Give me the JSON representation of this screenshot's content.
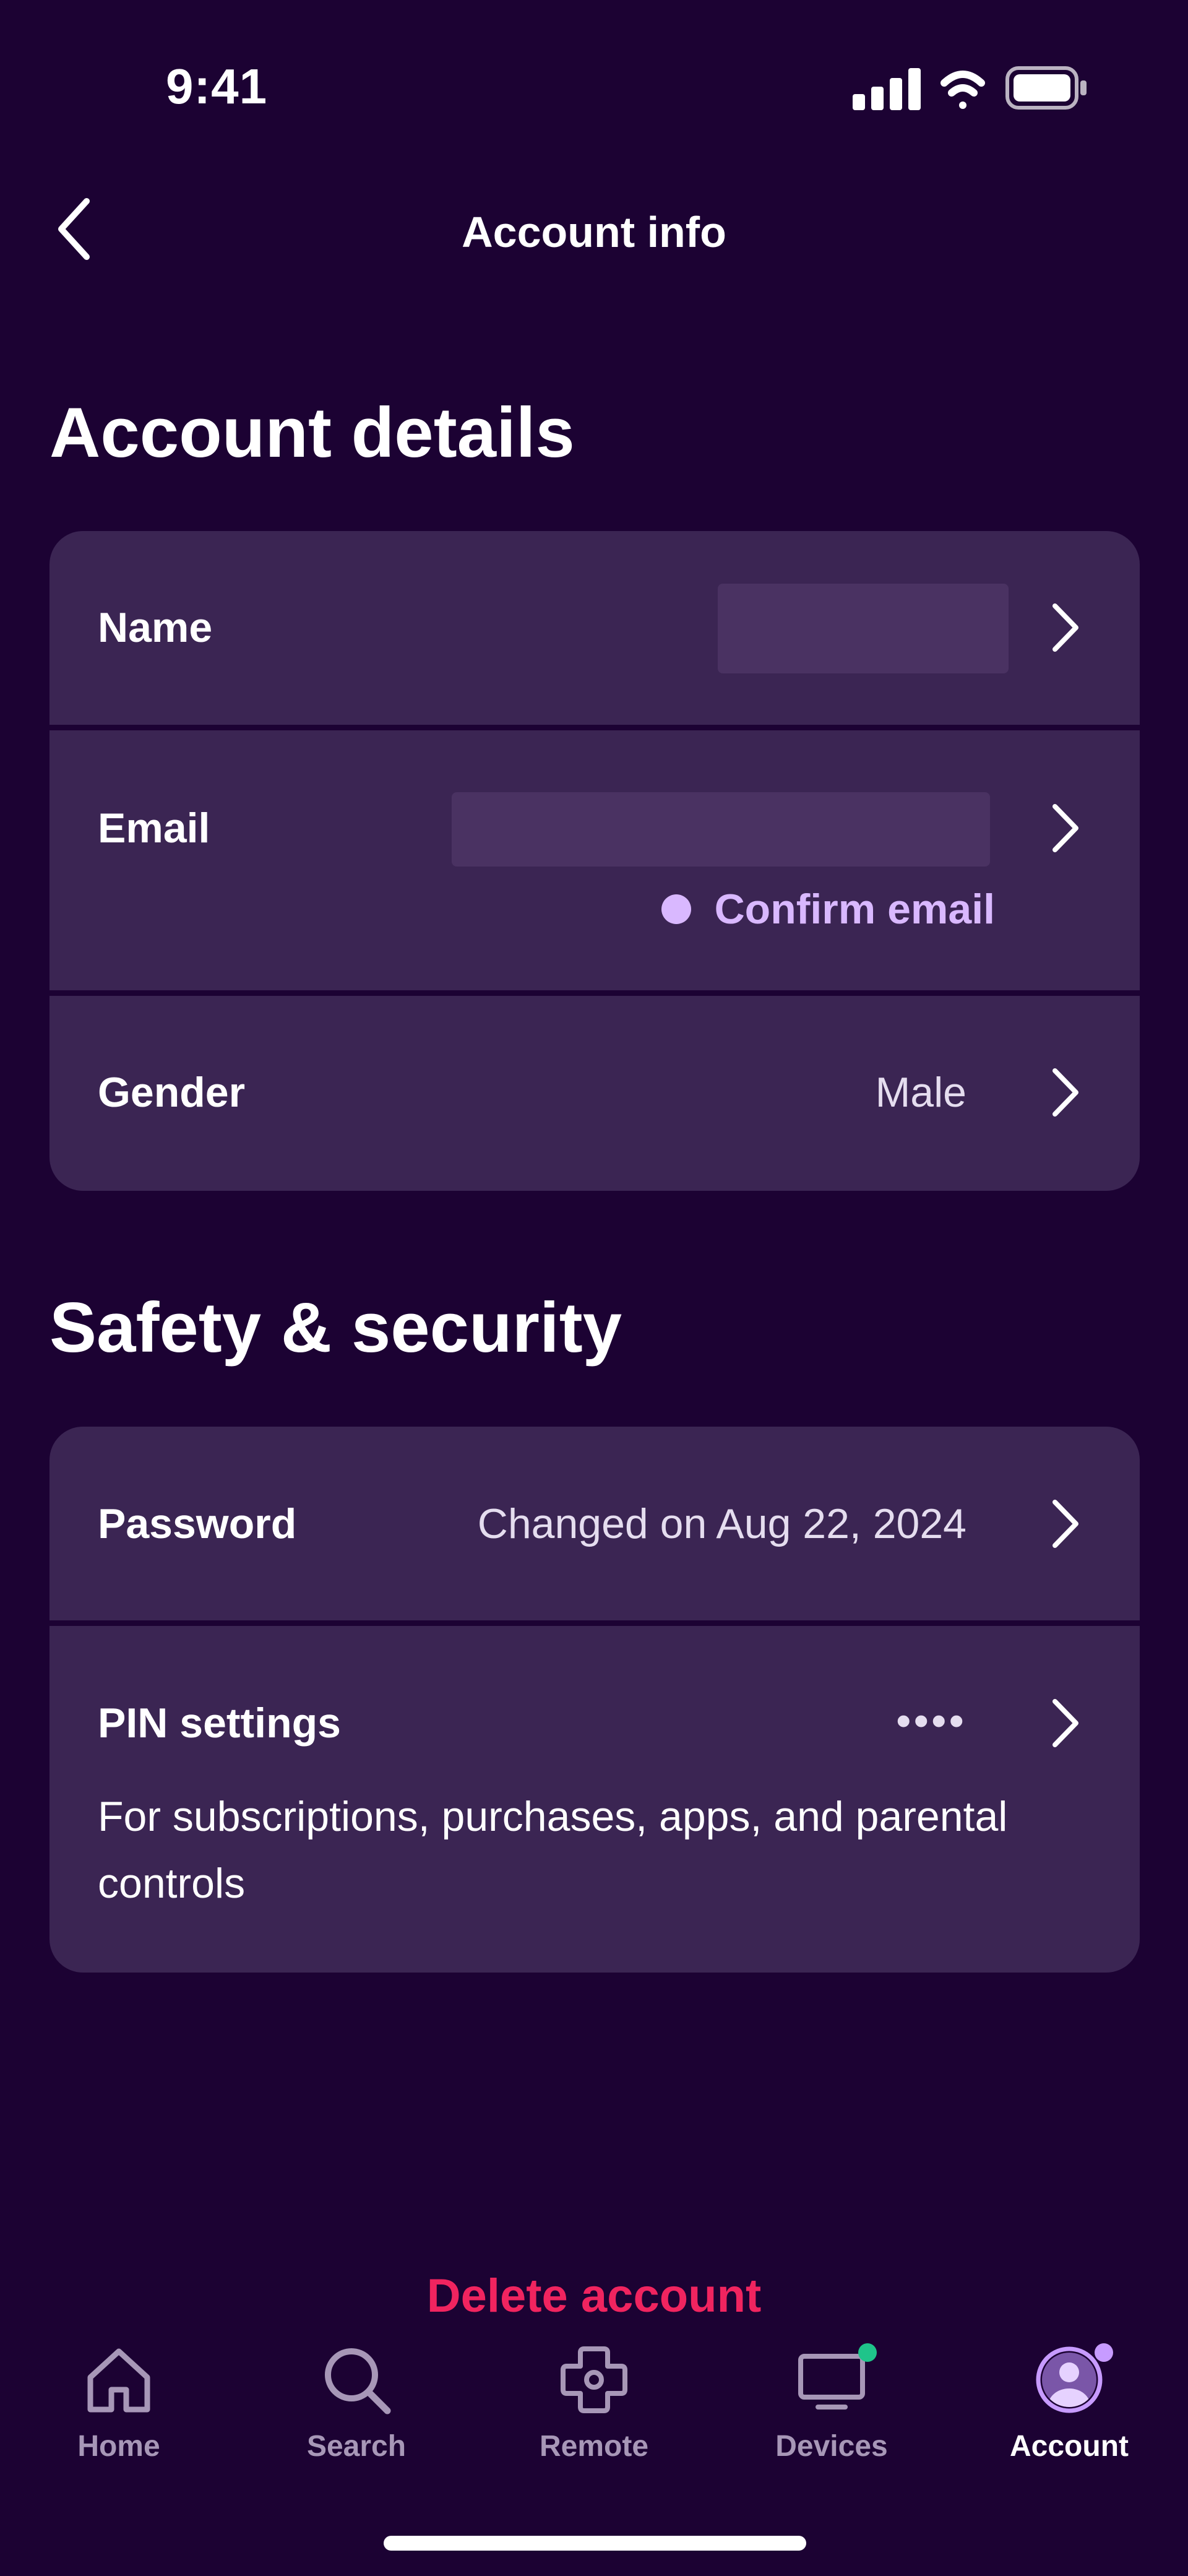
{
  "status_bar": {
    "time": "9:41"
  },
  "nav": {
    "title": "Account info"
  },
  "sections": {
    "account_details": {
      "title": "Account details",
      "rows": {
        "name": {
          "label": "Name"
        },
        "email": {
          "label": "Email",
          "status": "Confirm email"
        },
        "gender": {
          "label": "Gender",
          "value": "Male"
        }
      }
    },
    "safety": {
      "title": "Safety & security",
      "rows": {
        "password": {
          "label": "Password",
          "value": "Changed on Aug 22, 2024"
        },
        "pin": {
          "label": "PIN settings",
          "value": "••••",
          "description": "For subscriptions, purchases, apps, and parental controls"
        }
      }
    }
  },
  "delete_account": "Delete account",
  "tabs": [
    {
      "label": "Home",
      "icon": "home-icon"
    },
    {
      "label": "Search",
      "icon": "search-icon"
    },
    {
      "label": "Remote",
      "icon": "remote-icon"
    },
    {
      "label": "Devices",
      "icon": "tv-icon"
    },
    {
      "label": "Account",
      "icon": "account-icon",
      "active": true
    }
  ],
  "colors": {
    "background": "#1c0233",
    "card": "#3b2553",
    "accent_purple": "#d9b8ff",
    "delete_red": "#f0245f",
    "badge_green": "#1fc48a",
    "badge_purple": "#c79bff"
  }
}
